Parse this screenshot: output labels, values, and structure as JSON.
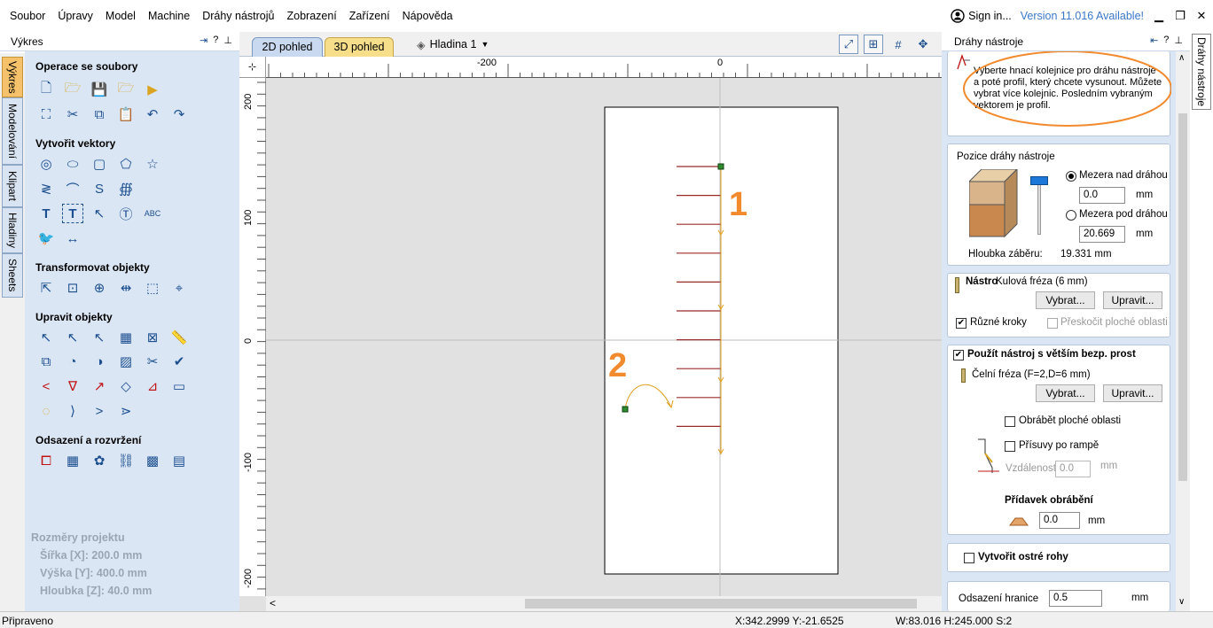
{
  "menu": [
    "Soubor",
    "Úpravy",
    "Model",
    "Machine",
    "Dráhy nástrojů",
    "Zobrazení",
    "Zařízení",
    "Nápověda"
  ],
  "menu_right": {
    "sign_in": "Sign in...",
    "version": "Version 11.016 Available!"
  },
  "left_panel": {
    "title": "Výkres",
    "tabs": [
      "Výkres",
      "Modelování",
      "Klipart",
      "Hladiny",
      "Sheets"
    ],
    "sections": {
      "files": "Operace se soubory",
      "create_vectors": "Vytvořit vektory",
      "transform": "Transformovat objekty",
      "edit": "Upravit objekty",
      "offset": "Odsazení a rozvržení"
    },
    "project": {
      "title": "Rozměry projektu",
      "width": "Šířka   [X]: 200.0 mm",
      "height": "Výška   [Y]: 400.0 mm",
      "depth": "Hloubka [Z]: 40.0 mm"
    }
  },
  "view": {
    "tab_2d": "2D pohled",
    "tab_3d": "3D pohled",
    "layer": "Hladina 1",
    "ruler_h": [
      "-200",
      "0"
    ],
    "ruler_v": [
      "200",
      "100",
      "0",
      "-100",
      "-200"
    ],
    "annotation_1": "1",
    "annotation_2": "2"
  },
  "right_panel": {
    "title": "Dráhy nástroje",
    "side_tab": "Dráhy nástroje",
    "instruction": "Vyberte hnací kolejnice pro dráhu nástroje a poté profil, který chcete vysunout. Můžete vybrat více kolejnic. Posledním vybraným vektorem je profil.",
    "position": {
      "title": "Pozice dráhy nástroje",
      "above": "Mezera nad dráhou",
      "above_value": "0.0",
      "below": "Mezera pod dráhou",
      "below_value": "20.669",
      "unit": "mm",
      "depth_label": "Hloubka záběru:",
      "depth_value": "19.331 mm"
    },
    "tool": {
      "label": "Nástroj",
      "name": "Kulová fréza (6 mm)",
      "select": "Vybrat...",
      "edit": "Upravit...",
      "multi_steps": "Různé kroky",
      "skip_flat": "Přeskočit ploché oblasti"
    },
    "larger_tool": {
      "label": "Použít nástroj s větším bezp. prost",
      "name": "Čelní fréza (F=2,D=6 mm)",
      "select": "Vybrat...",
      "edit": "Upravit...",
      "machine_flat": "Obrábět ploché oblasti",
      "ramp": "Přísuvy po rampě",
      "distance_label": "Vzdálenost",
      "distance_value": "0.0",
      "unit": "mm",
      "allowance_title": "Přídavek obrábění",
      "allowance_value": "0.0"
    },
    "sharp_corners": "Vytvořit ostré rohy",
    "boundary_offset": {
      "label": "Odsazení hranice",
      "value": "0.5",
      "unit": "mm"
    }
  },
  "status": {
    "ready": "Připraveno",
    "coords": "X:342.2999 Y:-21.6525",
    "size": "W:83.016  H:245.000  S:2"
  },
  "colors": {
    "accent_orange": "#f28a2e",
    "panel_blue": "#dbe6f4",
    "tab_active": "#f5c26b"
  }
}
